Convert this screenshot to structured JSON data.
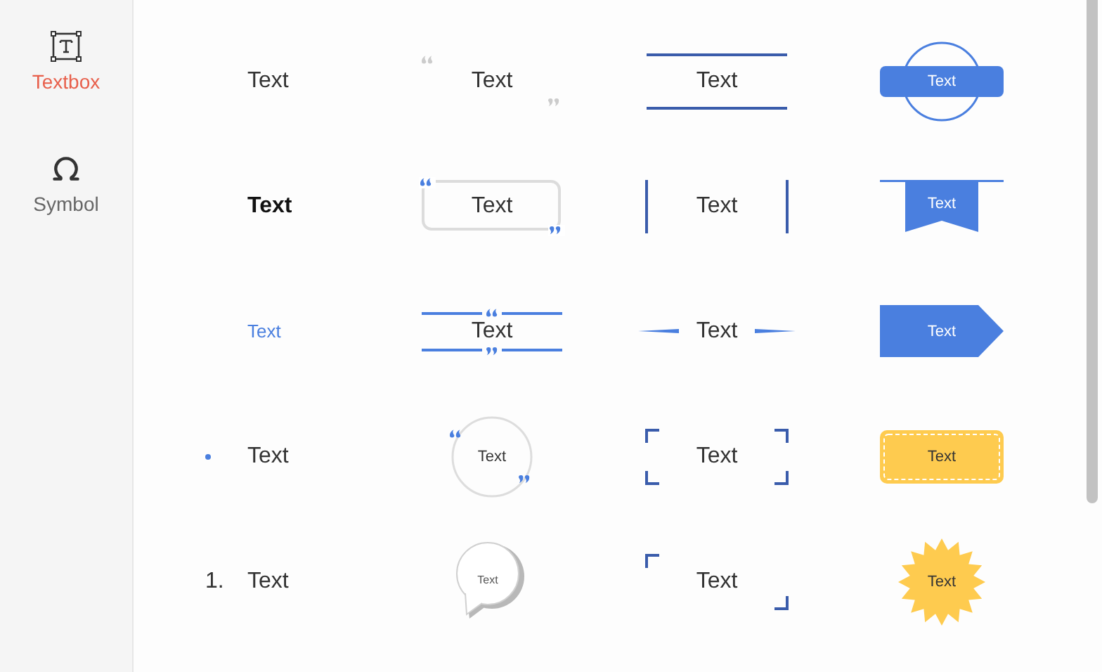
{
  "sidebar": {
    "items": [
      {
        "kind": "textbox",
        "label": "Textbox",
        "selected": true
      },
      {
        "kind": "symbol",
        "label": "Symbol",
        "selected": false
      }
    ]
  },
  "presets": [
    {
      "kind": "plain",
      "text": "Text"
    },
    {
      "kind": "quote-plain",
      "text": "Text"
    },
    {
      "kind": "double-rule",
      "text": "Text"
    },
    {
      "kind": "circle-banner",
      "text": "Text"
    },
    {
      "kind": "bold",
      "text": "Text"
    },
    {
      "kind": "quote-box",
      "text": "Text"
    },
    {
      "kind": "side-bars",
      "text": "Text"
    },
    {
      "kind": "ribbon",
      "text": "Text"
    },
    {
      "kind": "link",
      "text": "Text"
    },
    {
      "kind": "quote-lines",
      "text": "Text"
    },
    {
      "kind": "tapered-lines",
      "text": "Text"
    },
    {
      "kind": "arrow-tag",
      "text": "Text"
    },
    {
      "kind": "bullet",
      "text": "Text"
    },
    {
      "kind": "quote-circle",
      "text": "Text"
    },
    {
      "kind": "corner-brackets",
      "text": "Text"
    },
    {
      "kind": "dashed-tag",
      "text": "Text"
    },
    {
      "kind": "numbered",
      "marker": "1.",
      "text": "Text"
    },
    {
      "kind": "speech-bubble",
      "text": "Text"
    },
    {
      "kind": "two-corners",
      "text": "Text"
    },
    {
      "kind": "starburst",
      "text": "Text"
    }
  ]
}
